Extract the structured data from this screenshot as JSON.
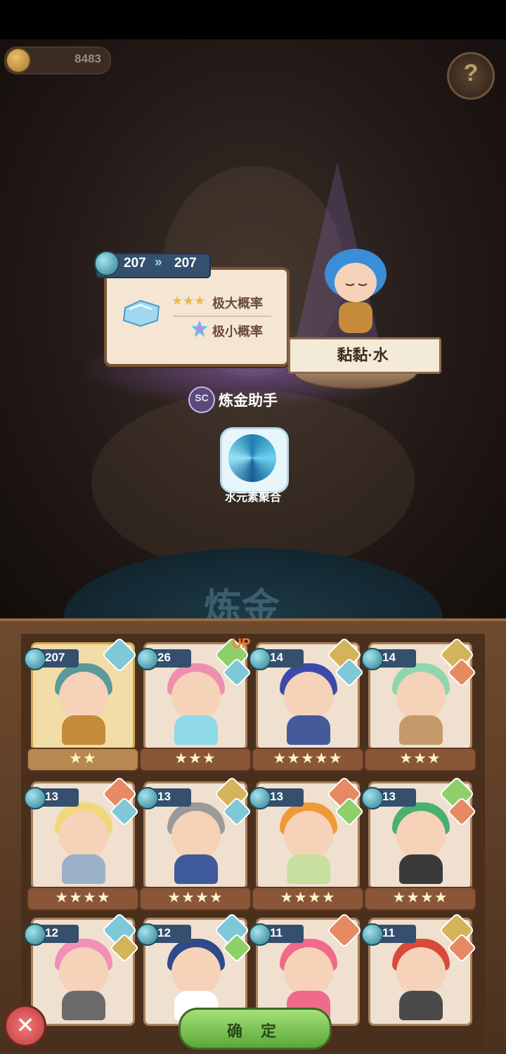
{
  "resources": {
    "coins": "8483",
    "help_symbol": "?"
  },
  "upgrade": {
    "level_from": "207",
    "level_to": "207",
    "arrow": "»",
    "prob_high_stars": "★★★",
    "prob_high_label": "极大概率",
    "prob_low_label": "极小概率"
  },
  "hero_name": "黏黏·水",
  "assistant": {
    "icon_text": "SC",
    "label": "炼金助手"
  },
  "skill": {
    "label": "水元素聚合"
  },
  "background_text": "炼金",
  "colors": {
    "water": "#7fc8d8",
    "leaf": "#8fcf6a",
    "earth": "#d4b35a",
    "fire": "#e58a62"
  },
  "cards": [
    {
      "level": "207",
      "stars": "★★",
      "selected": true,
      "hair": "#5a9a9a",
      "body": "#c58a3a",
      "el1": "water",
      "el2": null
    },
    {
      "level": "26",
      "stars": "★★★",
      "selected": false,
      "hair": "#ef8fb0",
      "body": "#8fd8e8",
      "el1": "leaf",
      "el2": "water"
    },
    {
      "level": "14",
      "stars": "★★★★★",
      "selected": false,
      "hair": "#3b4aa8",
      "body": "#445a9a",
      "el1": "earth",
      "el2": "water"
    },
    {
      "level": "14",
      "stars": "★★★",
      "selected": false,
      "hair": "#8fd6b0",
      "body": "#c49a6a",
      "el1": "earth",
      "el2": "fire"
    },
    {
      "level": "13",
      "stars": "★★★★",
      "selected": false,
      "hair": "#f0d878",
      "body": "#9ab0c8",
      "el1": "fire",
      "el2": "water"
    },
    {
      "level": "13",
      "stars": "★★★★",
      "selected": false,
      "hair": "#9a9a9a",
      "body": "#3e5a9a",
      "el1": "earth",
      "el2": "water"
    },
    {
      "level": "13",
      "stars": "★★★★",
      "selected": false,
      "hair": "#ee9a3a",
      "body": "#c7e0a0",
      "el1": "fire",
      "el2": "leaf"
    },
    {
      "level": "13",
      "stars": "★★★★",
      "selected": false,
      "hair": "#4ab070",
      "body": "#3a3a3a",
      "el1": "leaf",
      "el2": "fire"
    },
    {
      "level": "12",
      "stars": "",
      "selected": false,
      "hair": "#f08fb8",
      "body": "#6a6a6a",
      "el1": "water",
      "el2": "earth"
    },
    {
      "level": "12",
      "stars": "",
      "selected": false,
      "hair": "#2e4a8a",
      "body": "#ffffff",
      "el1": "water",
      "el2": "leaf"
    },
    {
      "level": "11",
      "stars": "",
      "selected": false,
      "hair": "#f06a8a",
      "body": "#f06a8a",
      "el1": "fire",
      "el2": null
    },
    {
      "level": "11",
      "stars": "",
      "selected": false,
      "hair": "#d84a3a",
      "body": "#4a4a4a",
      "el1": "earth",
      "el2": "fire"
    }
  ],
  "up_badge": "UP",
  "buttons": {
    "confirm": "确 定",
    "close": "✕"
  }
}
